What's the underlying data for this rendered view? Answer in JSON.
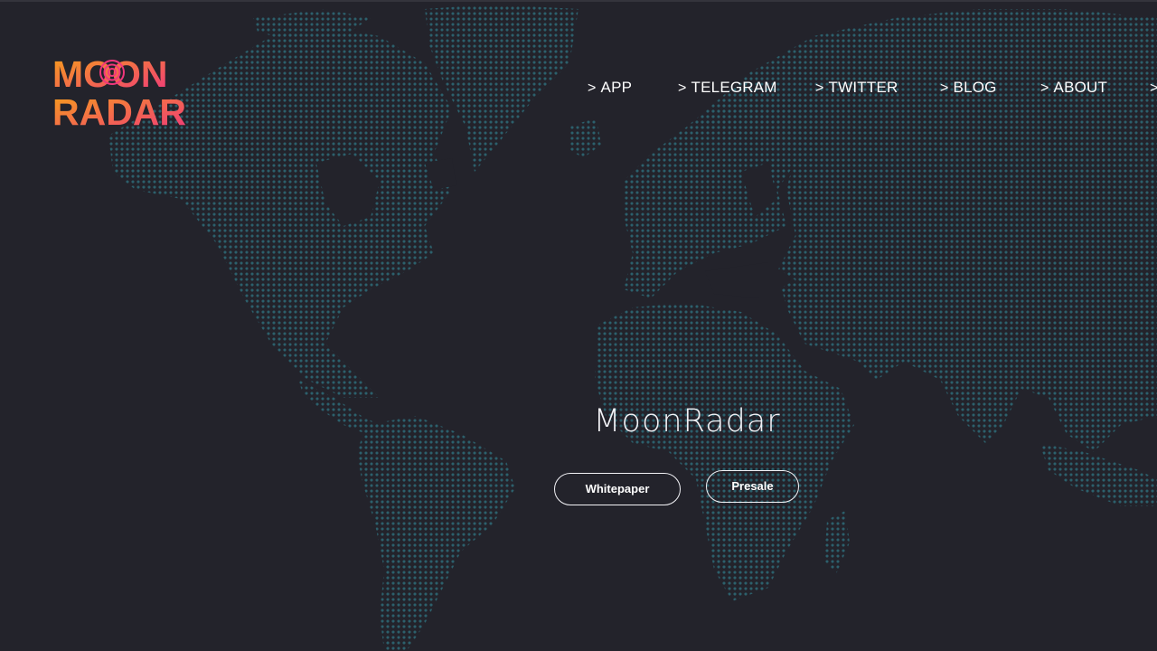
{
  "brand": {
    "logo_line1": "MOON",
    "logo_line2": "RADAR",
    "colors": {
      "gradient_start": "#f6a019",
      "gradient_end": "#f0377c"
    }
  },
  "nav": {
    "chevron": ">",
    "items": [
      {
        "label": "APP"
      },
      {
        "label": "TELEGRAM"
      },
      {
        "label": "TWITTER"
      },
      {
        "label": "BLOG"
      },
      {
        "label": "ABOUT"
      }
    ]
  },
  "hero": {
    "title": "MoonRadar",
    "buttons": {
      "whitepaper": "Whitepaper",
      "presale": "Presale"
    }
  },
  "colors": {
    "background": "#23232b",
    "map_dots": "#2e6b78"
  }
}
